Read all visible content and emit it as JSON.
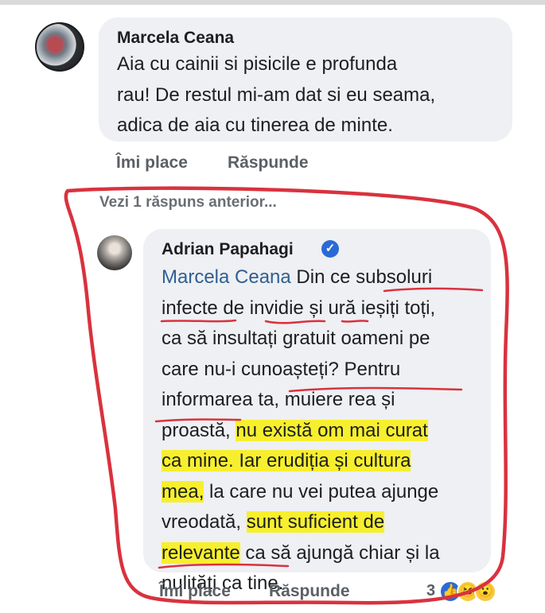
{
  "comment_1": {
    "author": "Marcela Ceana",
    "lines": [
      "Aia cu cainii si pisicile e profunda",
      "rau! De restul mi-am dat si eu seama,",
      "adica de aia cu tinerea de minte."
    ],
    "like_label": "Îmi place",
    "reply_label": "Răspunde"
  },
  "previous_replies_label": "Vezi 1 răspuns anterior...",
  "comment_2": {
    "author": "Adrian Papahagi",
    "mention": "Marcela Ceana",
    "line1_rest": " Din ce subsoluri",
    "line2": "infecte de invidie și ură ieșiți toți,",
    "line3": "ca să insultați gratuit oameni pe",
    "line4": "care nu-i cunoașteți? Pentru",
    "line5": "informarea ta, muiere rea și",
    "line6_a": "proastă, ",
    "line6_b": "nu există om mai curat",
    "line7": "ca mine. Iar erudiția și cultura",
    "line8_a": "mea,",
    "line8_b": " la care nu vei putea ajunge",
    "line9_a": "vreodată, ",
    "line9_b": "sunt suficient de",
    "line10_a": "relevante",
    "line10_b": " ca să ajungă chiar și la",
    "line11": "nulități ca tine.",
    "like_label": "Îmi place",
    "reply_label": "Răspunde",
    "reaction_count": "3",
    "reactions": [
      "like-icon",
      "haha-icon",
      "wow-icon"
    ]
  },
  "colors": {
    "bubble": "#eef0f3",
    "highlight": "#f7ef2e",
    "mention": "#2f5f92",
    "annotation_ink": "#d9323e",
    "verified": "#2a6ad6"
  }
}
